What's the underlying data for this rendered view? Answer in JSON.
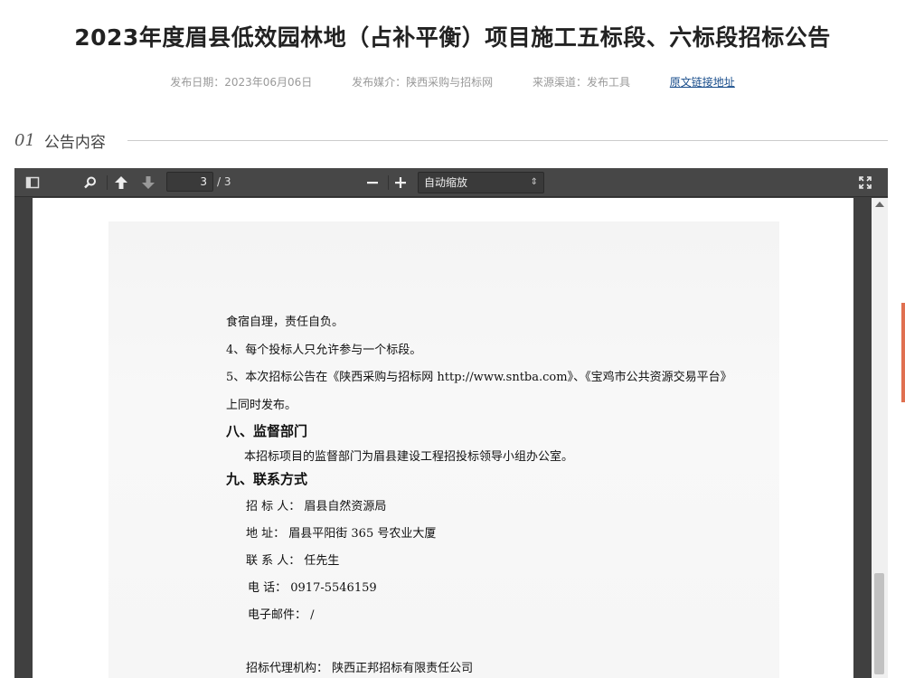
{
  "article": {
    "title": "2023年度眉县低效园林地（占补平衡）项目施工五标段、六标段招标公告",
    "meta": {
      "date": "发布日期：2023年06月06日",
      "media": "发布媒介：陕西采购与招标网",
      "source": "来源渠道：发布工具",
      "link": "原文链接地址"
    }
  },
  "section": {
    "num": "01",
    "label": "公告内容"
  },
  "viewer": {
    "page_current": "3",
    "page_total": "/ 3",
    "zoom": "自动缩放",
    "icons": [
      "sidebar-toggle-icon",
      "search-icon",
      "previous-page-icon",
      "next-page-icon",
      "zoom-out-icon",
      "zoom-in-icon",
      "fullscreen-icon"
    ]
  },
  "document": {
    "l1": "食宿自理，责任自负。",
    "l2": "4、每个投标人只允许参与一个标段。",
    "l3": "5、本次招标公告在《陕西采购与招标网 http://www.sntba.com》、《宝鸡市公共资源交易平台》",
    "l4": "上同时发布。",
    "h8": "八、监督部门",
    "l5": "本招标项目的监督部门为眉县建设工程招投标领导小组办公室。",
    "h9": "九、联系方式",
    "c1": "招 标 人：  眉县自然资源局",
    "c2": "地    址：  眉县平阳街 365 号农业大厦",
    "c3": "联 系 人：  任先生",
    "c4": "电    话：  0917-5546159",
    "c5": "电子邮件：  /",
    "c6": "招标代理机构：  陕西正邦招标有限责任公司"
  },
  "colors": {
    "toolbar": "#474747",
    "viewer_bg": "#404040",
    "link": "#1a4e8c"
  }
}
